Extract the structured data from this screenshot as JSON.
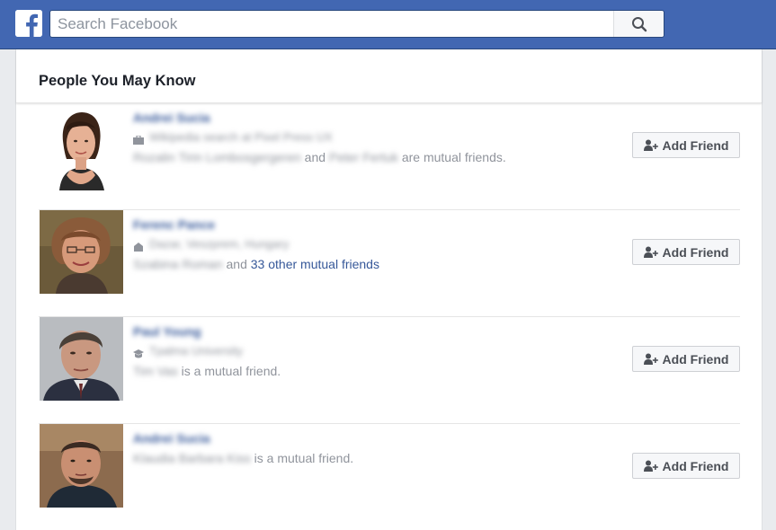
{
  "header": {
    "logo_icon": "facebook-f-logo",
    "search_placeholder": "Search Facebook",
    "search_icon": "magnifier-icon",
    "brand_color": "#4267b2"
  },
  "panel": {
    "title": "People You May Know"
  },
  "people": [
    {
      "name": "Andrei Sucia",
      "detail_icon": "briefcase-icon",
      "detail": "Wikipedia search at Pixel Press UX",
      "mutual_a": "Rozalin Tirin Lombosgergeren",
      "mutual_join": "and",
      "mutual_b": "Peter Fertuk",
      "mutual_suffix": "are mutual friends.",
      "button_label": "Add Friend"
    },
    {
      "name": "Ferenc Pance",
      "detail_icon": "house-icon",
      "detail": "Dazar, Veszprem, Hungary",
      "mutual_a": "Szabina Roman",
      "mutual_join": "and",
      "mutual_link": "33 other mutual friends",
      "button_label": "Add Friend"
    },
    {
      "name": "Paul Young",
      "detail_icon": "graduation-cap-icon",
      "detail": "Tpalma University",
      "mutual_a": "Tim Vas",
      "mutual_suffix": "is a mutual friend.",
      "button_label": "Add Friend"
    },
    {
      "name": "Andrei Sucia",
      "mutual_a": "Klaudia Barbara Kiss",
      "mutual_suffix": "is a mutual friend.",
      "button_label": "Add Friend"
    }
  ]
}
